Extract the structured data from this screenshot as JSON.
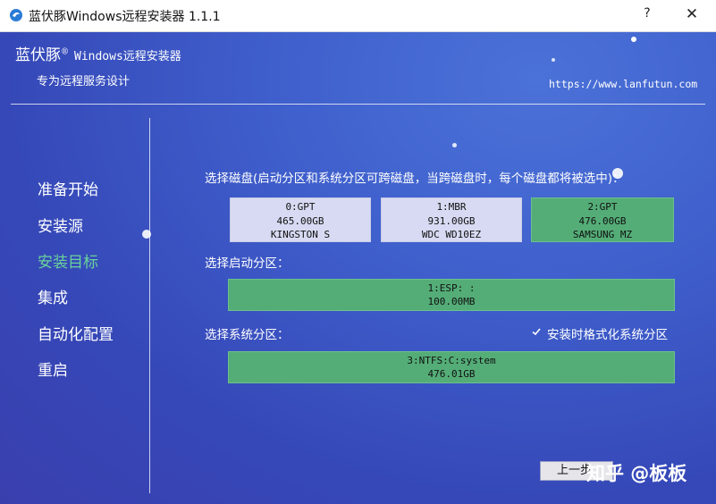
{
  "window": {
    "title": "蓝伏豚Windows远程安装器 1.1.1",
    "help": "?",
    "close": "✕"
  },
  "header": {
    "brand": "蓝伏豚",
    "brand_mark": "®",
    "brand_sub": "Windows远程安装器",
    "slogan": "专为远程服务设计",
    "url": "https://www.lanfutun.com"
  },
  "sidebar": {
    "items": [
      {
        "label": "准备开始",
        "active": false
      },
      {
        "label": "安装源",
        "active": false
      },
      {
        "label": "安装目标",
        "active": true
      },
      {
        "label": "集成",
        "active": false
      },
      {
        "label": "自动化配置",
        "active": false
      },
      {
        "label": "重启",
        "active": false
      }
    ]
  },
  "main": {
    "disk_label": "选择磁盘(启动分区和系统分区可跨磁盘，当跨磁盘时，每个磁盘都将被选中)：",
    "disks": [
      {
        "line1": "0:GPT",
        "line2": "465.00GB",
        "line3": "KINGSTON S"
      },
      {
        "line1": "1:MBR",
        "line2": "931.00GB",
        "line3": "WDC WD10EZ"
      },
      {
        "line1": "2:GPT",
        "line2": "476.00GB",
        "line3": "SAMSUNG MZ"
      }
    ],
    "boot_label": "选择启动分区：",
    "boot_partition": {
      "line1": "1:ESP: :",
      "line2": "100.00MB"
    },
    "system_label": "选择系统分区：",
    "format_checkbox": {
      "checked": true,
      "label": "安装时格式化系统分区"
    },
    "system_partition": {
      "line1": "3:NTFS:C:system",
      "line2": "476.01GB"
    }
  },
  "footer": {
    "prev_button": "上一步",
    "watermark": "知乎 @板板"
  },
  "colors": {
    "accent_green": "#54ad77",
    "active_nav": "#6ad39b",
    "background_blue": "#3f5fcc"
  }
}
